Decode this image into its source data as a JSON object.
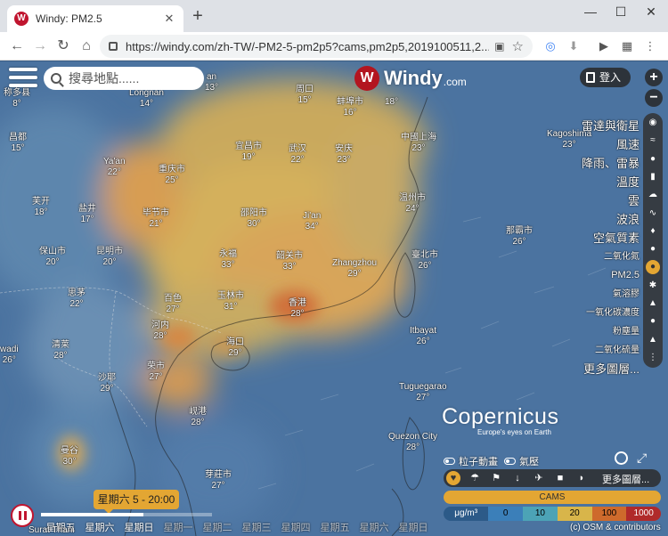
{
  "browser": {
    "tab_title": "Windy: PM2.5",
    "favicon": "W",
    "tab_close": "✕",
    "new_tab": "+",
    "url": "https://windy.com/zh-TW/-PM2-5-pm2p5?cams,pm2p5,2019100511,2...",
    "window_minimize": "—",
    "window_maximize": "☐",
    "window_close": "✕"
  },
  "map": {
    "search_placeholder": "搜尋地點......",
    "logo_text": "Windy",
    "logo_domain": ".com",
    "login_label": "登入",
    "zoom_in": "+",
    "zoom_out": "−",
    "cities": [
      {
        "name": "称多县",
        "temp": "8°"
      },
      {
        "name": "Longnan",
        "temp": "14°"
      },
      {
        "name": "an",
        "temp": "13°"
      },
      {
        "name": "周口",
        "temp": "15°"
      },
      {
        "name": "蚌埠市",
        "temp": "16°"
      },
      {
        "name": "",
        "temp": "18°"
      },
      {
        "name": "昌都",
        "temp": "15°"
      },
      {
        "name": "Ya'an",
        "temp": "22°"
      },
      {
        "name": "重庆市",
        "temp": "25°"
      },
      {
        "name": "宜昌市",
        "temp": "19°"
      },
      {
        "name": "武汉",
        "temp": "22°"
      },
      {
        "name": "安庆",
        "temp": "23°"
      },
      {
        "name": "中國上海",
        "temp": "23°"
      },
      {
        "name": "Kagoshima",
        "temp": "23°"
      },
      {
        "name": "芙开",
        "temp": "18°"
      },
      {
        "name": "盐井",
        "temp": "17°"
      },
      {
        "name": "毕节市",
        "temp": "21°"
      },
      {
        "name": "邵阳市",
        "temp": "30°"
      },
      {
        "name": "Ji'an",
        "temp": "34°"
      },
      {
        "name": "温州市",
        "temp": "24°"
      },
      {
        "name": "那霸市",
        "temp": "26°"
      },
      {
        "name": "保山市",
        "temp": "20°"
      },
      {
        "name": "昆明市",
        "temp": "20°"
      },
      {
        "name": "永福",
        "temp": "33°"
      },
      {
        "name": "韶关市",
        "temp": "33°"
      },
      {
        "name": "Zhangzhou",
        "temp": "29°"
      },
      {
        "name": "臺北市",
        "temp": "26°"
      },
      {
        "name": "思茅",
        "temp": "22°"
      },
      {
        "name": "百色",
        "temp": "27°"
      },
      {
        "name": "玉林市",
        "temp": "31°"
      },
      {
        "name": "香港",
        "temp": "28°"
      },
      {
        "name": "河内",
        "temp": "28°"
      },
      {
        "name": "Itbayat",
        "temp": "26°"
      },
      {
        "name": "清莱",
        "temp": "28°"
      },
      {
        "name": "海口",
        "temp": "29°"
      },
      {
        "name": "wadi",
        "temp": "26°"
      },
      {
        "name": "沙耶",
        "temp": "29°"
      },
      {
        "name": "荣市",
        "temp": "27°"
      },
      {
        "name": "Tuguegarao",
        "temp": "27°"
      },
      {
        "name": "岘港",
        "temp": "28°"
      },
      {
        "name": "Quezon City",
        "temp": "28°"
      },
      {
        "name": "曼谷",
        "temp": "30°"
      },
      {
        "name": "芽莊市",
        "temp": "27°"
      }
    ]
  },
  "layers": [
    {
      "label": "雷達與衛星",
      "icon": "◉"
    },
    {
      "label": "風速",
      "icon": "≈"
    },
    {
      "label": "降雨、雷暴",
      "icon": "●"
    },
    {
      "label": "溫度",
      "icon": "▮"
    },
    {
      "label": "雲",
      "icon": "☁"
    },
    {
      "label": "波浪",
      "icon": "∿"
    },
    {
      "label": "空氣質素",
      "icon": "♦"
    },
    {
      "label": "二氧化氮",
      "icon": "●"
    },
    {
      "label": "PM2.5",
      "icon": "●"
    },
    {
      "label": "氣溶膠",
      "icon": "✱"
    },
    {
      "label": "一氧化碳濃度",
      "icon": "▲"
    },
    {
      "label": "粉塵量",
      "icon": "●"
    },
    {
      "label": "二氧化硫量",
      "icon": "▲"
    },
    {
      "label": "更多圖層...",
      "icon": "⋮"
    }
  ],
  "bottom_panel": {
    "copernicus": "Copernicus",
    "copernicus_tag": "Europe's eyes on Earth",
    "particles_label": "粒子動畫",
    "pressure_label": "氣壓",
    "more_layers": "更多圖層...",
    "overlay_icons": [
      "♥",
      "☂",
      "⚑",
      "↓",
      "✈",
      "■",
      "◗"
    ],
    "model": "CAMS",
    "scale_unit": "μg/m³",
    "scale_values": [
      "0",
      "10",
      "20",
      "100",
      "1000"
    ],
    "scale_colors": [
      "#3b7fb9",
      "#4ca3b6",
      "#d8b54a",
      "#ce6a2c",
      "#b02a2a"
    ],
    "attribution": "(c) OSM & contributors"
  },
  "timeline": {
    "current": "星期六 5 - 20:00",
    "progress": 0.6,
    "days": [
      "星期五",
      "星期六",
      "星期日",
      "星期一",
      "星期二",
      "星期三",
      "星期四",
      "星期五",
      "星期六",
      "星期日"
    ],
    "bottom_city": "Surat Thani"
  }
}
